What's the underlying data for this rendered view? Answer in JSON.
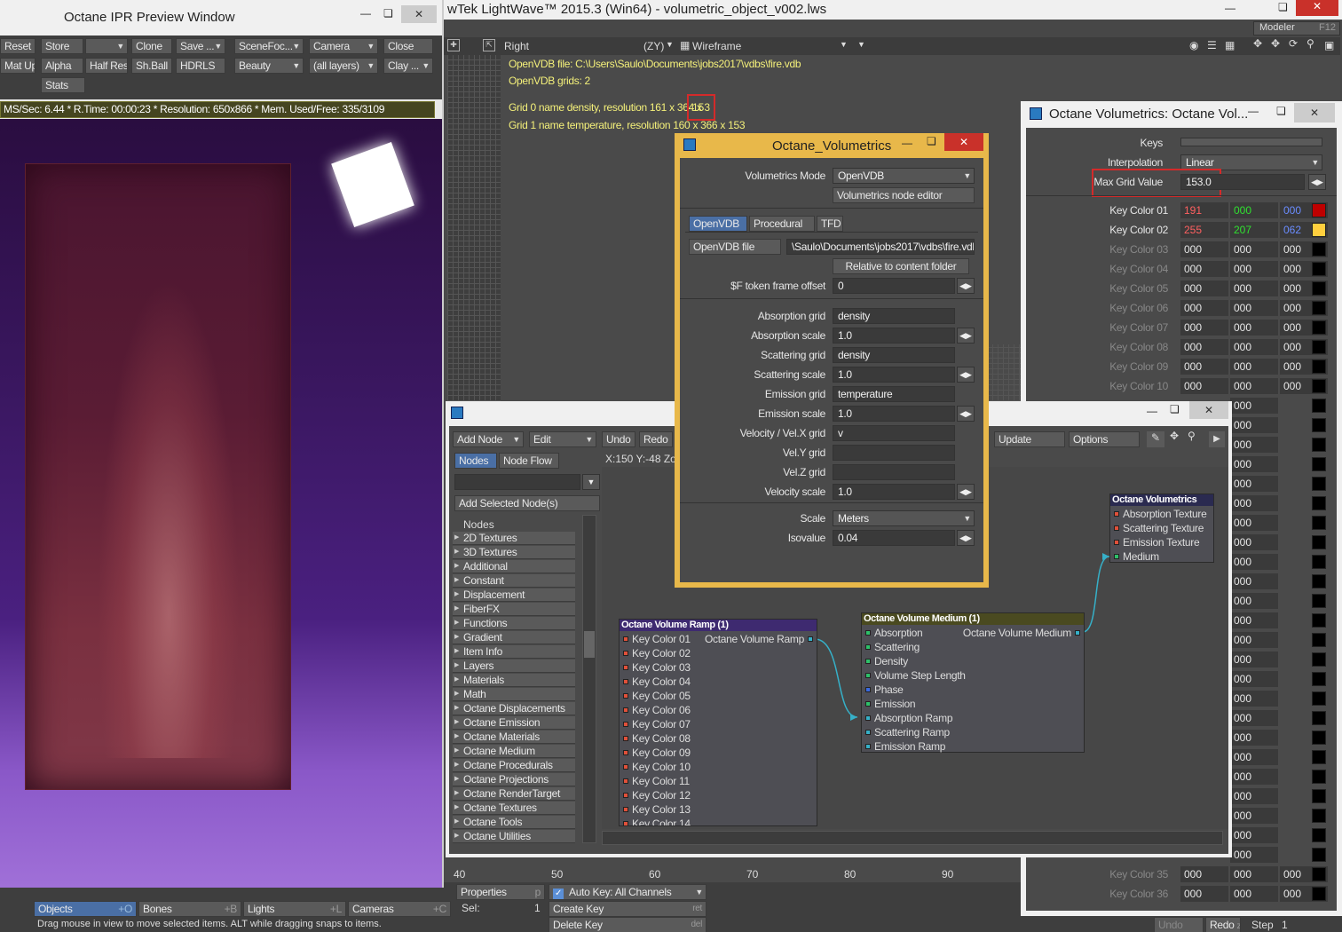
{
  "ipr": {
    "title": "Octane IPR Preview Window",
    "toolbar_row1": [
      "Reset",
      "Store",
      "",
      "Clone",
      "Save ...",
      "SceneFoc...",
      "Camera",
      "Close"
    ],
    "toolbar_row2": [
      "Mat Upd",
      "Alpha",
      "Half Res",
      "Sh.Ball",
      "HDRLS",
      "Beauty",
      "(all layers)",
      "Clay ..."
    ],
    "stats_button": "Stats",
    "status": "MS/Sec: 6.44  *  R.Time: 00:00:23  *  Resolution: 650x866  *  Mem. Used/Free: 335/3109"
  },
  "main": {
    "title": "wTek LightWave™ 2015.3 (Win64) - volumetric_object_v002.lws",
    "modeler": "Modeler",
    "modeler_key": "F12",
    "viewport": {
      "view": "Right",
      "axis": "(ZY)",
      "mode": "Wireframe",
      "info": [
        "OpenVDB file: C:\\Users\\Saulo\\Documents\\jobs2017\\vdbs\\fire.vdb",
        "OpenVDB grids: 2",
        "Grid 0 name density, resolution 161 x 364 x",
        "153",
        "Grid 1 name temperature, resolution 160 x 366 x 153"
      ]
    },
    "ruler": [
      "40",
      "50",
      "60",
      "70",
      "80",
      "90"
    ],
    "bottom": {
      "properties": "Properties",
      "properties_key": "p",
      "autokey": "Auto Key: All Channels",
      "tabs": [
        {
          "label": "Objects",
          "key": "+O"
        },
        {
          "label": "Bones",
          "key": "+B"
        },
        {
          "label": "Lights",
          "key": "+L"
        },
        {
          "label": "Cameras",
          "key": "+C"
        }
      ],
      "sel_label": "Sel:",
      "sel_value": "1",
      "create_key": "Create Key",
      "create_key_shortcut": "ret",
      "delete_key": "Delete Key",
      "delete_key_shortcut": "del",
      "undo": "Undo",
      "redo": "Redo",
      "redo_key": "z",
      "step_label": "Step",
      "step_value": "1",
      "hint": "Drag mouse in view to move selected items. ALT while dragging snaps to items."
    }
  },
  "ramp_panel": {
    "title": "Octane Volumetrics: Octane Vol...",
    "keys_label": "Keys",
    "interp_label": "Interpolation",
    "interp_value": "Linear",
    "maxgrid_label": "Max Grid Value",
    "maxgrid_value": "153.0",
    "keys": [
      {
        "label": "Key Color 01",
        "r": "191",
        "g": "000",
        "b": "000",
        "color": "#bf0000"
      },
      {
        "label": "Key Color 02",
        "r": "255",
        "g": "207",
        "b": "062",
        "color": "#ffcf3e"
      },
      {
        "label": "Key Color 03",
        "r": "000",
        "g": "000",
        "b": "000",
        "color": "#000000"
      },
      {
        "label": "Key Color 04",
        "r": "000",
        "g": "000",
        "b": "000",
        "color": "#000000"
      },
      {
        "label": "Key Color 05",
        "r": "000",
        "g": "000",
        "b": "000",
        "color": "#000000"
      },
      {
        "label": "Key Color 06",
        "r": "000",
        "g": "000",
        "b": "000",
        "color": "#000000"
      },
      {
        "label": "Key Color 07",
        "r": "000",
        "g": "000",
        "b": "000",
        "color": "#000000"
      },
      {
        "label": "Key Color 08",
        "r": "000",
        "g": "000",
        "b": "000",
        "color": "#000000"
      },
      {
        "label": "Key Color 09",
        "r": "000",
        "g": "000",
        "b": "000",
        "color": "#000000"
      },
      {
        "label": "Key Color 10",
        "r": "000",
        "g": "000",
        "b": "000",
        "color": "#000000"
      }
    ],
    "bottom_keys": [
      {
        "label": "Key Color 35",
        "r": "000",
        "g": "000",
        "b": "000"
      },
      {
        "label": "Key Color 36",
        "r": "000",
        "g": "000",
        "b": "000"
      }
    ],
    "right_col_value": "000"
  },
  "volumetrics": {
    "title": "Octane_Volumetrics",
    "mode_label": "Volumetrics Mode",
    "mode_value": "OpenVDB",
    "node_editor": "Volumetrics node editor",
    "tabs": [
      "OpenVDB",
      "Procedural",
      "TFD"
    ],
    "file_button": "OpenVDB file",
    "file_path": "\\Saulo\\Documents\\jobs2017\\vdbs\\fire.vdb",
    "relative": "Relative to content folder",
    "token_label": "$F token frame offset",
    "token_value": "0",
    "fields": [
      {
        "label": "Absorption grid",
        "value": "density",
        "spin": false
      },
      {
        "label": "Absorption scale",
        "value": "1.0",
        "spin": true
      },
      {
        "label": "Scattering grid",
        "value": "density",
        "spin": false
      },
      {
        "label": "Scattering scale",
        "value": "1.0",
        "spin": true
      },
      {
        "label": "Emission grid",
        "value": "temperature",
        "spin": false
      },
      {
        "label": "Emission scale",
        "value": "1.0",
        "spin": true
      },
      {
        "label": "Velocity / Vel.X grid",
        "value": "v",
        "spin": false
      },
      {
        "label": "Vel.Y grid",
        "value": "",
        "spin": false
      },
      {
        "label": "Vel.Z grid",
        "value": "",
        "spin": false
      },
      {
        "label": "Velocity scale",
        "value": "1.0",
        "spin": true
      }
    ],
    "scale_label": "Scale",
    "scale_value": "Meters",
    "iso_label": "Isovalue",
    "iso_value": "0.04"
  },
  "node_editor": {
    "add_node": "Add Node",
    "edit": "Edit",
    "undo": "Undo",
    "redo": "Redo",
    "update": "Update",
    "options": "Options",
    "tabs": [
      "Nodes",
      "Node Flow"
    ],
    "add_selected": "Add Selected Node(s)",
    "coords": "X:150 Y:-48 Zoo",
    "tree_header": "Nodes",
    "categories": [
      "2D Textures",
      "3D Textures",
      "Additional",
      "Constant",
      "Displacement",
      "FiberFX",
      "Functions",
      "Gradient",
      "Item Info",
      "Layers",
      "Materials",
      "Math",
      "Octane Displacements",
      "Octane Emission",
      "Octane Materials",
      "Octane Medium",
      "Octane Procedurals",
      "Octane Projections",
      "Octane RenderTarget",
      "Octane Textures",
      "Octane Tools",
      "Octane Utilities"
    ],
    "ramp_node": {
      "title": "Octane Volume Ramp (1)",
      "output": "Octane Volume Ramp",
      "inputs": [
        "Key Color 01",
        "Key Color 02",
        "Key Color 03",
        "Key Color 04",
        "Key Color 05",
        "Key Color 06",
        "Key Color 07",
        "Key Color 08",
        "Key Color 09",
        "Key Color 10",
        "Key Color 11",
        "Key Color 12",
        "Key Color 13",
        "Key Color 14"
      ]
    },
    "medium_node": {
      "title": "Octane Volume Medium (1)",
      "output": "Octane Volume Medium",
      "inputs": [
        "Absorption",
        "Scattering",
        "Density",
        "Volume Step Length",
        "Phase",
        "Emission",
        "Absorption Ramp",
        "Scattering Ramp",
        "Emission Ramp"
      ]
    },
    "vol_node": {
      "title": "Octane Volumetrics",
      "inputs": [
        "Absorption Texture",
        "Scattering Texture",
        "Emission Texture",
        "Medium"
      ]
    }
  },
  "colors": {
    "accent": "#e8b84a",
    "highlight_box": "#d42a2a",
    "close_red": "#c9312a"
  }
}
